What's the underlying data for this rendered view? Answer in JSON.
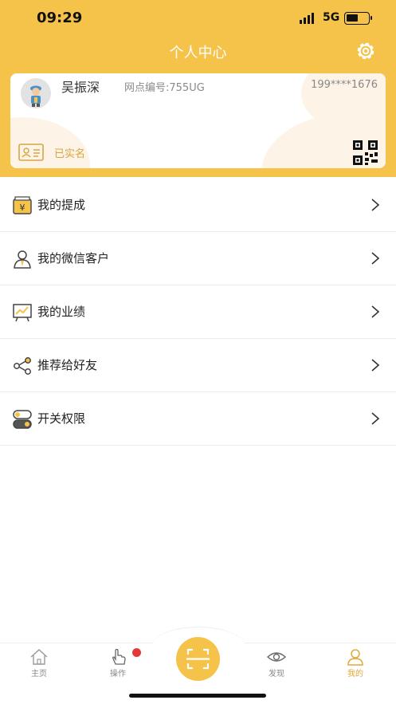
{
  "status_bar": {
    "time": "09:29",
    "network": "5G"
  },
  "header": {
    "title": "个人中心"
  },
  "profile": {
    "name": "吴振深",
    "outlet_label": "网点编号:755UG",
    "phone": "199****1676",
    "verified_label": "已实名"
  },
  "menu": [
    {
      "label": "我的提成",
      "icon": "commission-icon"
    },
    {
      "label": "我的微信客户",
      "icon": "wechat-customer-icon"
    },
    {
      "label": "我的业绩",
      "icon": "performance-chart-icon"
    },
    {
      "label": "推荐给好友",
      "icon": "share-icon"
    },
    {
      "label": "开关权限",
      "icon": "toggle-permission-icon"
    }
  ],
  "tabbar": {
    "items": [
      {
        "label": "主页",
        "icon": "home-icon"
      },
      {
        "label": "操作",
        "icon": "hand-pointer-icon"
      },
      {
        "label": "发现",
        "icon": "eye-icon"
      },
      {
        "label": "我的",
        "icon": "user-icon"
      }
    ],
    "active": "我的"
  },
  "colors": {
    "primary": "#f5c24a",
    "accent_text": "#d7a640",
    "badge": "#e53935"
  }
}
